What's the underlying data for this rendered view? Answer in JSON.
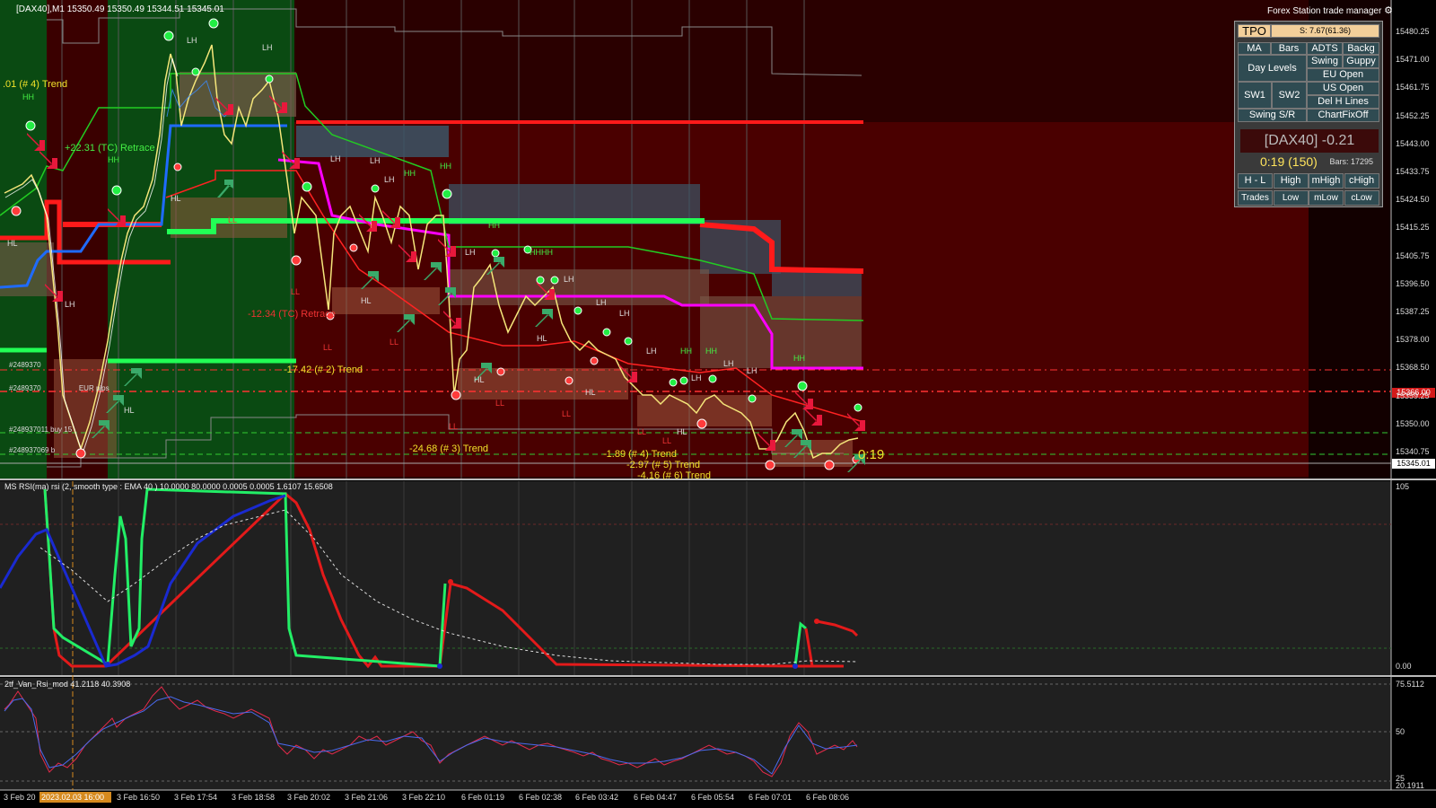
{
  "window": {
    "symbol_title": "[DAX40],M1  15350.49 15350.49 15344.51 15345.01",
    "trade_manager_title": "Forex Station trade manager"
  },
  "icons": {
    "settings": "gear-icon"
  },
  "trade_manager": {
    "tpo": "TPO",
    "tpo_info": "S: 7.67(61.36)",
    "buttons": [
      "MA",
      "Bars",
      "ADTS",
      "Backg",
      "Day Levels",
      "Swing",
      "Guppy",
      "EU Open",
      "SW1",
      "SW2",
      "US Open",
      "Del H Lines",
      "Swing S/R",
      "ChartFixOff"
    ],
    "symbol_value": "[DAX40] -0.21",
    "timer": "0:19 (150)",
    "bars_count": "Bars: 17295",
    "level_buttons": [
      "H - L",
      "High",
      "mHigh",
      "cHigh",
      "Trades",
      "Low",
      "mLow",
      "cLow"
    ]
  },
  "price_axis": {
    "ticks": [
      "15480.25",
      "15471.00",
      "15461.75",
      "15452.25",
      "15443.00",
      "15433.75",
      "15424.50",
      "15415.25",
      "15405.75",
      "15396.50",
      "15387.25",
      "15378.00",
      "15368.50",
      "15359.25",
      "15350.00",
      "15340.75"
    ],
    "current_price": "15345.01",
    "marker_price": "15366.00"
  },
  "annotations": {
    "trend_1": ".01 (# 4) Trend",
    "retrace_1": "+22.31 (TC) Retrace",
    "retrace_2": "-12.34 (TC) Retrace",
    "trend_2": "-17.42 (# 2) Trend",
    "trend_3": "-24.68 (# 3) Trend",
    "trend_4": "-1.89 (# 4) Trend",
    "trend_5": "-2.97 (# 5) Trend",
    "trend_6": "-4.16 (# 6) Trend",
    "countdown": "0:19"
  },
  "swing_labels": {
    "HH": "HH",
    "LH": "LH",
    "HL": "HL",
    "LL": "LL",
    "HHHH": "HHHH"
  },
  "orders": {
    "order_1": "#2489370",
    "order_2": "#2489370",
    "order_2_suffix": "EUR   pips",
    "order_3": "#248937011 buy 15",
    "order_4": "#248937069 b"
  },
  "indicator_1": {
    "title": "MS RSI(ma) rsi (2, smooth type : EMA  40 ) 10.0000 80.0000 0.0005 0.0005 1.6107 15.6508",
    "axis_top": "105",
    "axis_bottom": "0.00"
  },
  "indicator_2": {
    "title": "2tf_Van_Rsi_mod 41.2118 40.3908",
    "axis_top": "75.5112",
    "axis_mid": "50",
    "axis_low": "25",
    "axis_bottom": "20.1911"
  },
  "time_axis": {
    "highlight": "2023.02.03 16:00",
    "ticks": [
      "3 Feb 20",
      "3 Feb 16:50",
      "3 Feb 17:54",
      "3 Feb 18:58",
      "3 Feb 20:02",
      "3 Feb 21:06",
      "3 Feb 22:10",
      "6 Feb 01:19",
      "6 Feb 02:38",
      "6 Feb 03:42",
      "6 Feb 04:47",
      "6 Feb 05:54",
      "6 Feb 07:01",
      "6 Feb 08:06"
    ]
  },
  "colors": {
    "bull": "#00ff55",
    "bear": "#ff1a1a",
    "magenta": "#ff00ff",
    "green_zone": "#0b5a12",
    "red_zone": "#4a0000",
    "blue_line": "#1f6bff"
  }
}
